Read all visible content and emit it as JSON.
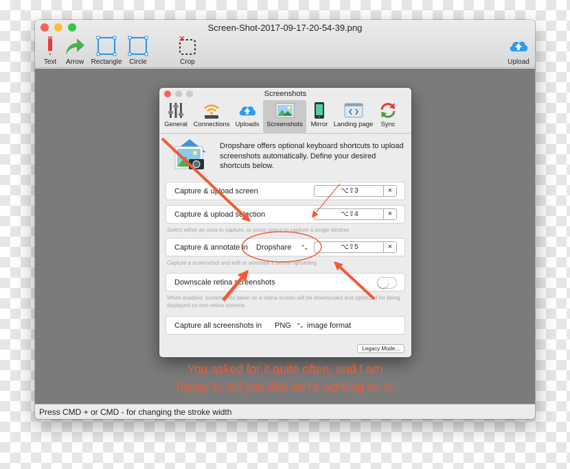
{
  "window": {
    "title": "Screen-Shot-2017-09-17-20-54-39.png",
    "lights": [
      "#fc605c",
      "#fdbc40",
      "#34c84a"
    ]
  },
  "toolbar": {
    "tools": [
      {
        "label": "Text",
        "icon": "pencil-icon"
      },
      {
        "label": "Arrow",
        "icon": "arrow-icon"
      },
      {
        "label": "Rectangle",
        "icon": "rectangle-icon"
      },
      {
        "label": "Circle",
        "icon": "circle-icon"
      },
      {
        "label": "Crop",
        "icon": "crop-icon"
      }
    ],
    "upload": {
      "label": "Upload",
      "icon": "cloud-upload-icon"
    }
  },
  "dialog": {
    "title": "Screenshots",
    "tabs": [
      {
        "label": "General",
        "icon": "sliders-icon"
      },
      {
        "label": "Connections",
        "icon": "wifi-icon"
      },
      {
        "label": "Uploads",
        "icon": "cloud-upload-icon"
      },
      {
        "label": "Screenshots",
        "icon": "picture-icon",
        "active": true
      },
      {
        "label": "Mirror",
        "icon": "phone-icon"
      },
      {
        "label": "Landing page",
        "icon": "webpage-icon"
      },
      {
        "label": "Sync",
        "icon": "sync-icon"
      }
    ],
    "intro": "Dropshare offers optional keyboard shortcuts to upload screenshots automatically. Define your desired shortcuts below.",
    "rows": {
      "capture_screen": {
        "label": "Capture & upload screen",
        "shortcut": "⌥⇧3"
      },
      "capture_selection": {
        "label": "Capture & upload selection",
        "shortcut": "⌥⇧4"
      },
      "selection_note": "Select either an area to capture, or press space to capture a single window",
      "capture_annotate": {
        "label": "Capture & annotate in",
        "app": "Dropshare",
        "shortcut": "⌥⇧5"
      },
      "annotate_note": "Capture a screenshot and edit or annotate it before uploading",
      "downscale": {
        "label": "Downscale retina screenshots",
        "enabled": false
      },
      "downscale_note": "When enabled, screenshots taken on a retina screen will be downscaled and optimzed for being displayed on non-retina screens",
      "format": {
        "prefix": "Capture all screenshots in",
        "value": "PNG",
        "suffix": "image format"
      }
    },
    "clear_glyph": "×",
    "stepper_glyph": "⌃⌄",
    "legacy_button": "Legacy Mode..."
  },
  "annotation": {
    "line1": "You asked for it quite often, and I am",
    "line2": "happy to tell you that we're working on it!",
    "color": "#f15a35"
  },
  "status": "Press CMD + or CMD - for changing the stroke width"
}
